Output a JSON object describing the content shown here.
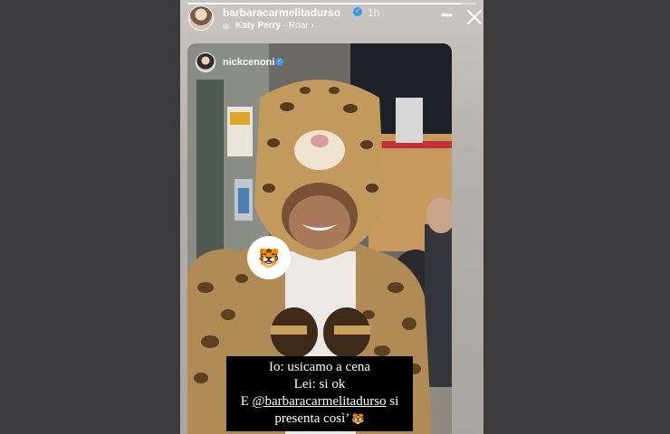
{
  "story": {
    "username": "barbaracarmelitadurso",
    "verified_icon": "verified-badge-icon",
    "time": "1h",
    "music": {
      "artist": "Katy Perry",
      "song": "Roar",
      "separator": " · ",
      "chevron": "›"
    },
    "progress": 0.95
  },
  "repost": {
    "username": "nickcenoni",
    "verified_icon": "verified-badge-icon"
  },
  "sticker": {
    "emoji": "🐯",
    "icon": "tiger-face-icon"
  },
  "caption": {
    "line1": "Io: usicamo a cena",
    "line2": "Lei: si ok",
    "line3_prefix": "E ",
    "mention": "@barbaracarmelitadurso",
    "line3_suffix": " si",
    "line4": "presenta così’",
    "line4_emoji": "🐯"
  },
  "colors": {
    "sidebar": "#3b3b3d",
    "verified": "#3897f0",
    "caption_bg": "#000000",
    "text": "#ffffff"
  }
}
